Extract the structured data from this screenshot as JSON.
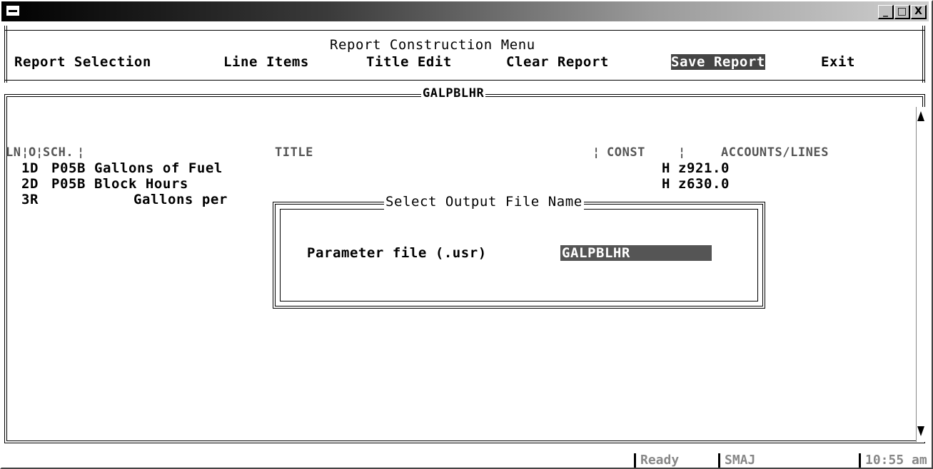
{
  "window": {
    "controls": [
      "minimize-icon",
      "maximize-icon",
      "close-icon"
    ],
    "control_glyphs": [
      "_",
      "□",
      "X"
    ]
  },
  "menu": {
    "title": "Report Construction Menu",
    "items": [
      "Report Selection",
      "Line Items",
      "Title Edit",
      "Clear Report",
      "Save Report",
      "Exit"
    ],
    "selected": "Save Report"
  },
  "report": {
    "name": "GALPBLHR",
    "headers": {
      "ln": "LN",
      "o": "O",
      "sch": "SCH.",
      "title": "TITLE",
      "const": "CONST",
      "accounts": "ACCOUNTS/LINES"
    },
    "rows": [
      {
        "ln": "1",
        "o": "D",
        "sch": "P05B",
        "title": "Gallons of Fuel",
        "const": "H",
        "accounts": "z921.0"
      },
      {
        "ln": "2",
        "o": "D",
        "sch": "P05B",
        "title": "Block Hours",
        "const": "H",
        "accounts": "z630.0"
      },
      {
        "ln": "3",
        "o": "R",
        "sch": "",
        "title": "Gallons per",
        "const": "",
        "accounts": ""
      }
    ]
  },
  "dialog": {
    "title": "Select Output File Name",
    "label": "Parameter file (.usr)",
    "value": "GALPBLHR"
  },
  "status": {
    "state": "Ready",
    "user": "SMAJ",
    "time": "10:55 am"
  }
}
